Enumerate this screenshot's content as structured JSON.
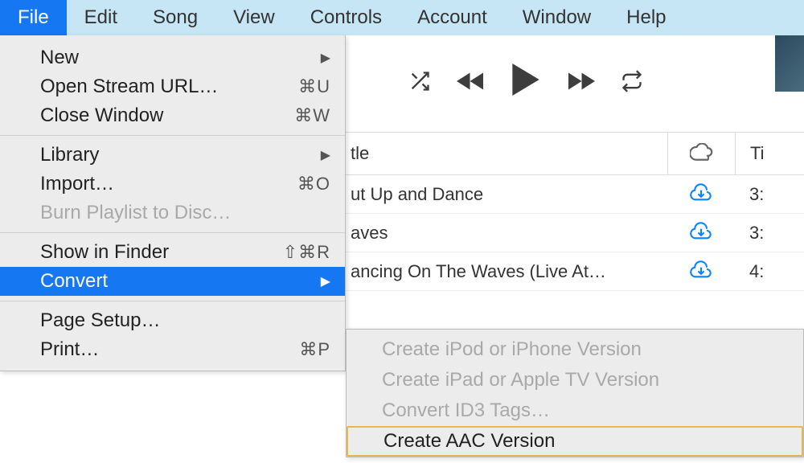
{
  "menubar": {
    "items": [
      {
        "label": "File",
        "active": true
      },
      {
        "label": "Edit"
      },
      {
        "label": "Song"
      },
      {
        "label": "View"
      },
      {
        "label": "Controls"
      },
      {
        "label": "Account"
      },
      {
        "label": "Window"
      },
      {
        "label": "Help"
      }
    ]
  },
  "file_menu": {
    "new": "New",
    "open_stream": "Open Stream URL…",
    "open_stream_sc": "⌘U",
    "close_window": "Close Window",
    "close_window_sc": "⌘W",
    "library": "Library",
    "import": "Import…",
    "import_sc": "⌘O",
    "burn": "Burn Playlist to Disc…",
    "show_in_finder": "Show in Finder",
    "show_in_finder_sc": "⇧⌘R",
    "convert": "Convert",
    "page_setup": "Page Setup…",
    "print": "Print…",
    "print_sc": "⌘P"
  },
  "convert_submenu": {
    "ipod": "Create iPod or iPhone Version",
    "ipad": "Create iPad or Apple TV Version",
    "id3": "Convert ID3 Tags…",
    "aac": "Create AAC Version"
  },
  "table": {
    "header_title_fragment": "tle",
    "header_time_fragment": "Ti",
    "rows": [
      {
        "title_fragment": "ut Up and Dance",
        "time_fragment": "3:"
      },
      {
        "title_fragment": "aves",
        "time_fragment": "3:"
      },
      {
        "title_fragment": "ancing On The Waves (Live At…",
        "time_fragment": "4:"
      }
    ]
  }
}
